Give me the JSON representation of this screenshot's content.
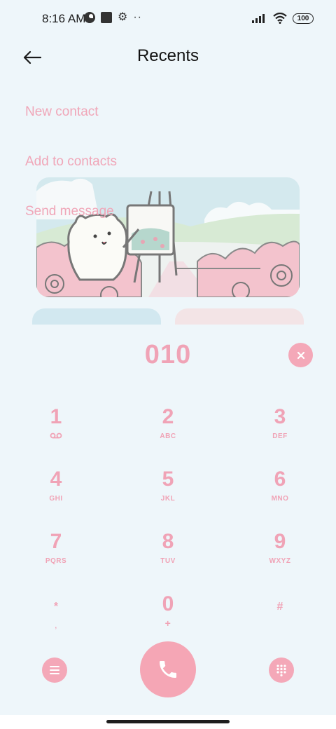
{
  "status_bar": {
    "time": "8:16 AM",
    "battery": "100",
    "icons": [
      "vpn-icon",
      "square-icon",
      "gear-icon",
      "more-dots-icon",
      "signal-icon",
      "wifi-icon",
      "battery-icon"
    ]
  },
  "header": {
    "title": "Recents",
    "back_icon": "back-arrow-icon"
  },
  "actions": [
    {
      "label": "New contact"
    },
    {
      "label": "Add to contacts"
    },
    {
      "label": "Send message"
    }
  ],
  "dialer": {
    "number": "010",
    "delete_icon": "close-icon",
    "keys": [
      {
        "digit": "1",
        "letters": ""
      },
      {
        "digit": "2",
        "letters": "ABC"
      },
      {
        "digit": "3",
        "letters": "DEF"
      },
      {
        "digit": "4",
        "letters": "GHI"
      },
      {
        "digit": "5",
        "letters": "JKL"
      },
      {
        "digit": "6",
        "letters": "MNO"
      },
      {
        "digit": "7",
        "letters": "PQRS"
      },
      {
        "digit": "8",
        "letters": "TUV"
      },
      {
        "digit": "9",
        "letters": "WXYZ"
      },
      {
        "digit": "*",
        "letters": ","
      },
      {
        "digit": "0",
        "letters": "+"
      },
      {
        "digit": "#",
        "letters": ""
      }
    ]
  },
  "bottom": {
    "menu_icon": "menu-icon",
    "call_icon": "phone-icon",
    "keypad_icon": "dialpad-icon"
  },
  "colors": {
    "background": "#eef6fa",
    "accent_pink": "#f0a3b6",
    "call_button": "#f5a6b5"
  }
}
